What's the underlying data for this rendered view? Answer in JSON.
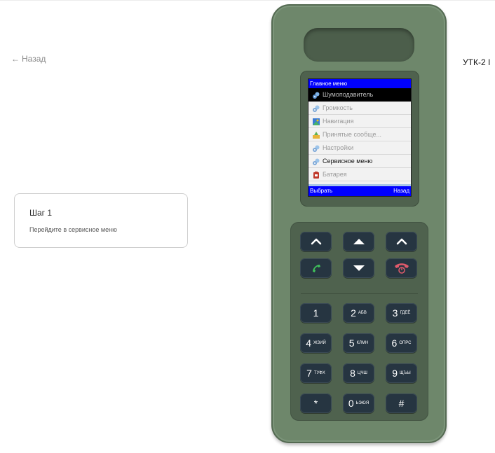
{
  "nav": {
    "back_label": "Назад",
    "back_arrow": "←"
  },
  "step": {
    "title": "Шаг 1",
    "description": "Перейдите в сервисное меню"
  },
  "device": {
    "title": "УТК-2 I"
  },
  "screen": {
    "header": "Главное меню",
    "items": [
      {
        "label": "Шумоподавитель",
        "icon": "gears-icon",
        "state": "selected"
      },
      {
        "label": "Громкость",
        "icon": "gears-icon",
        "state": "normal"
      },
      {
        "label": "Навигация",
        "icon": "map-icon",
        "state": "normal"
      },
      {
        "label": "Принятые сообще...",
        "icon": "messages-icon",
        "state": "normal"
      },
      {
        "label": "Настройки",
        "icon": "gears-icon",
        "state": "normal"
      },
      {
        "label": "Сервисное меню",
        "icon": "gears-icon",
        "state": "active"
      },
      {
        "label": "Батарея",
        "icon": "battery-icon",
        "state": "normal"
      }
    ],
    "softkey_left": "Выбрать",
    "softkey_right": "Назад"
  },
  "keypad": {
    "nav_keys": [
      {
        "name": "left-softkey",
        "icon": "chevron-up-icon"
      },
      {
        "name": "up",
        "icon": "triangle-up-icon"
      },
      {
        "name": "right-softkey",
        "icon": "chevron-up-icon"
      },
      {
        "name": "call",
        "icon": "phone-call-icon"
      },
      {
        "name": "down",
        "icon": "triangle-down-icon"
      },
      {
        "name": "end",
        "icon": "power-end-icon"
      }
    ],
    "keys": [
      {
        "main": "1",
        "sub": ""
      },
      {
        "main": "2",
        "sub": "АБВ"
      },
      {
        "main": "3",
        "sub": "ГДЕЁ"
      },
      {
        "main": "4",
        "sub": "ЖЗИЙ"
      },
      {
        "main": "5",
        "sub": "КЛМН"
      },
      {
        "main": "6",
        "sub": "ОПРС"
      },
      {
        "main": "7",
        "sub": "ТУФХ"
      },
      {
        "main": "8",
        "sub": "ЦЧШ"
      },
      {
        "main": "9",
        "sub": "ЩЪЫ"
      },
      {
        "main": "*",
        "sub": ""
      },
      {
        "main": "0",
        "sub": "ЬЭЮЯ"
      },
      {
        "main": "#",
        "sub": ""
      }
    ]
  },
  "colors": {
    "phone_body": "#6e876b",
    "screen_header": "#0000ff",
    "key_dark": "#263541",
    "call_green": "#3fbf5a",
    "end_red": "#e05a6b"
  }
}
